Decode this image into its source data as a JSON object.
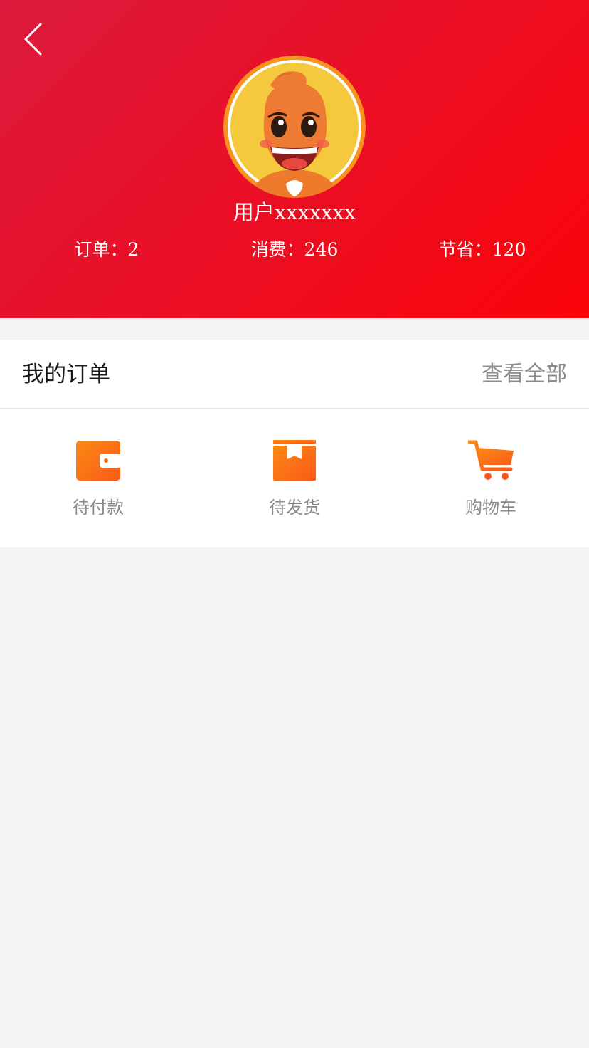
{
  "header": {
    "username": "用户xxxxxxx",
    "stats": [
      {
        "label": "订单：2"
      },
      {
        "label": "消费：246"
      },
      {
        "label": "节省：120"
      }
    ]
  },
  "orders": {
    "title": "我的订单",
    "view_all": "查看全部",
    "items": [
      {
        "label": "待付款",
        "icon": "wallet-icon"
      },
      {
        "label": "待发货",
        "icon": "package-box-icon"
      },
      {
        "label": "购物车",
        "icon": "shopping-cart-icon"
      }
    ]
  },
  "colors": {
    "header_gradient_start": "#dc1a3c",
    "header_gradient_end": "#fb0409",
    "icon_orange": "#fb6a14",
    "page_background": "#f4f4f4"
  }
}
